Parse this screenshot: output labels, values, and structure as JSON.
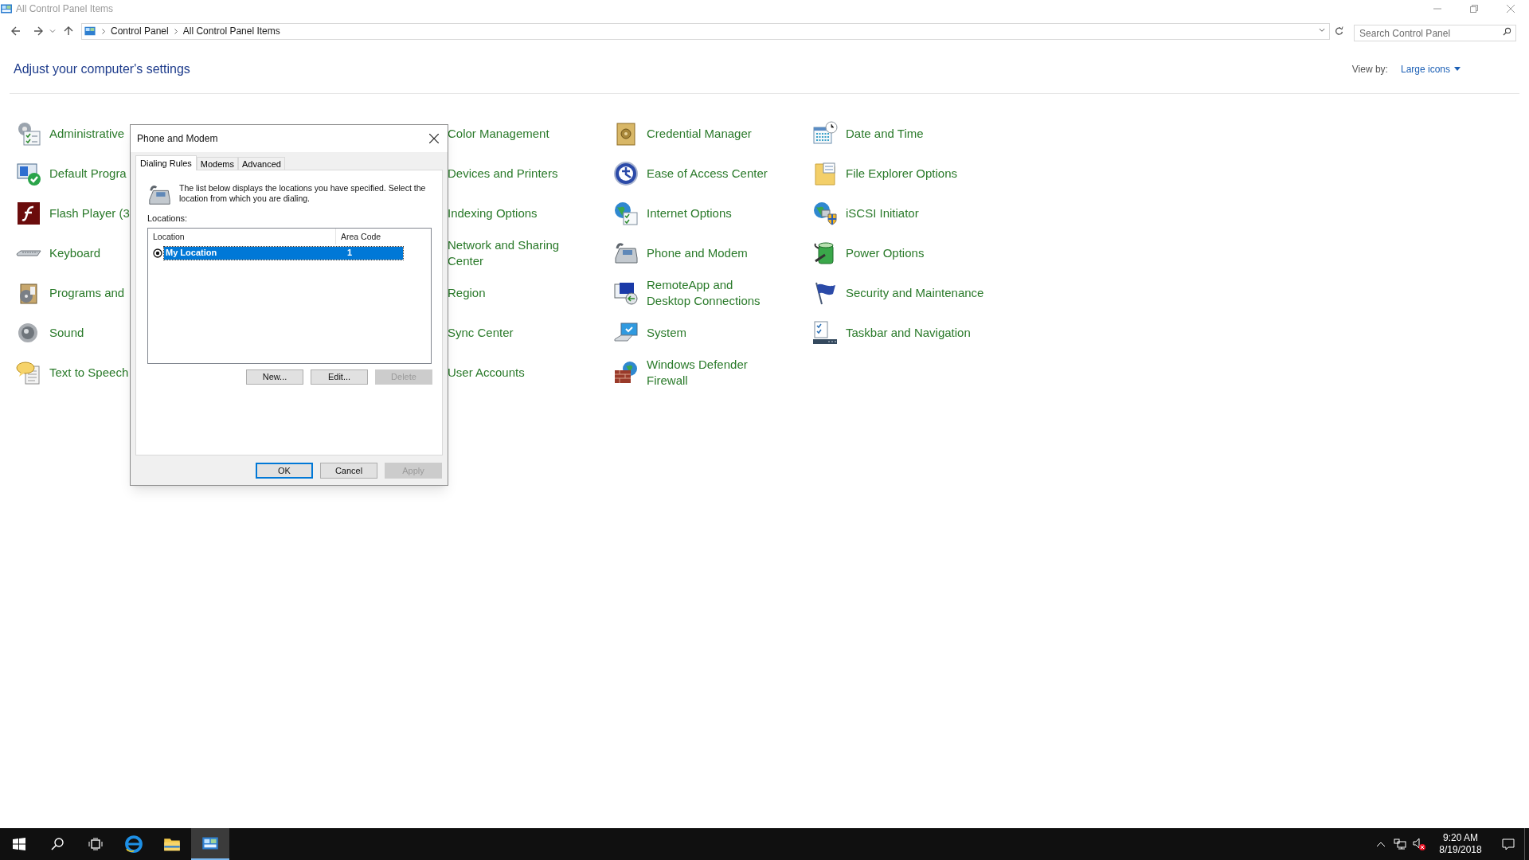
{
  "window": {
    "title": "All Control Panel Items"
  },
  "address_bar": {
    "breadcrumbs": [
      "Control Panel",
      "All Control Panel Items"
    ]
  },
  "search": {
    "placeholder": "Search Control Panel"
  },
  "heading": "Adjust your computer's settings",
  "view_by": {
    "label": "View by:",
    "value": "Large icons"
  },
  "columns": [
    [
      "Administrative",
      "Default Progra",
      "Flash Player (3",
      "Keyboard",
      "Programs and",
      "Sound",
      "Text to Speech"
    ],
    [
      "Color Management",
      "Devices and Printers",
      "Indexing Options",
      "Network and Sharing Center",
      "Region",
      "Sync Center",
      "User Accounts"
    ],
    [
      "Credential Manager",
      "Ease of Access Center",
      "Internet Options",
      "Phone and Modem",
      "RemoteApp and Desktop Connections",
      "System",
      "Windows Defender Firewall"
    ],
    [
      "Date and Time",
      "File Explorer Options",
      "iSCSI Initiator",
      "Power Options",
      "Security and Maintenance",
      "Taskbar and Navigation"
    ]
  ],
  "dialog": {
    "title": "Phone and Modem",
    "tabs": [
      {
        "label": "Dialing Rules",
        "selected": true
      },
      {
        "label": "Modems",
        "selected": false
      },
      {
        "label": "Advanced",
        "selected": false
      }
    ],
    "description": "The list below displays the locations you have specified. Select the location from which you are dialing.",
    "list_label": "Locations:",
    "table": {
      "columns": [
        "Location",
        "Area Code"
      ],
      "rows": [
        {
          "location": "My Location",
          "area_code": "1",
          "selected": true
        }
      ]
    },
    "list_buttons": [
      {
        "label": "New...",
        "disabled": false
      },
      {
        "label": "Edit...",
        "disabled": false
      },
      {
        "label": "Delete",
        "disabled": true
      }
    ],
    "buttons": [
      {
        "label": "OK",
        "default": true,
        "disabled": false
      },
      {
        "label": "Cancel",
        "default": false,
        "disabled": false
      },
      {
        "label": "Apply",
        "default": false,
        "disabled": true
      }
    ]
  },
  "taskbar": {
    "apps": [
      {
        "selected": false
      },
      {
        "selected": false
      },
      {
        "selected": true
      }
    ],
    "time": "9:20 AM",
    "date": "8/19/2018"
  }
}
